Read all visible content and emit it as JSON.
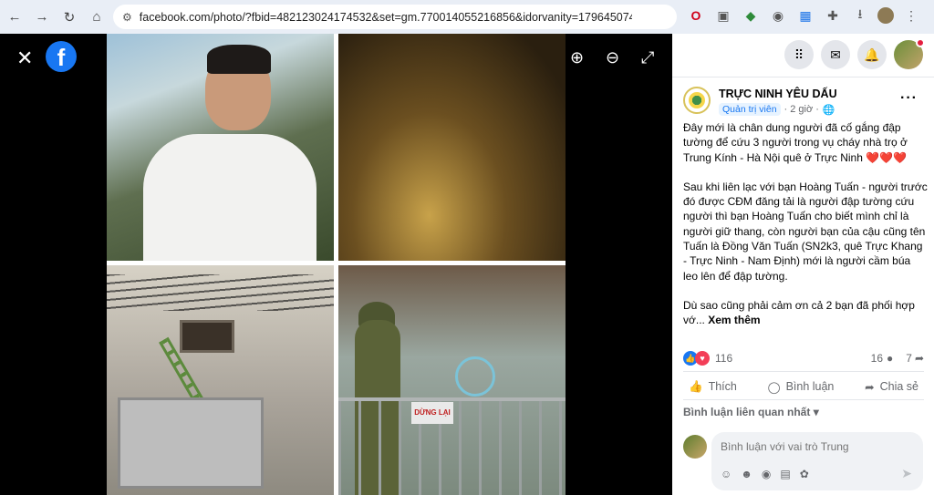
{
  "browser": {
    "url": "facebook.com/photo/?fbid=482123024174532&set=gm.770014055216856&idorvanity=179645074253760",
    "nav": {
      "back": "←",
      "forward": "→",
      "reload": "↻",
      "home": "⌂"
    }
  },
  "viewer": {
    "close": "✕",
    "logo": "f",
    "zoom_in": "⊕",
    "zoom_out": "⊖",
    "fullscreen": "⤢",
    "sign_text": "DỪNG LẠI"
  },
  "post": {
    "group_name": "TRỰC NINH YÊU DẤU",
    "role": "Quản trị viên",
    "time": "· 2 giờ ·",
    "paragraph_1": "Đây mới là chân dung người đã cố gắng đập tường để cứu 3 người trong vụ cháy nhà trọ ở Trung Kính - Hà Nội quê ở Trực Ninh ❤️❤️❤️",
    "paragraph_2": "Sau khi liên lạc với bạn Hoàng Tuấn - người trước đó được CĐM đăng tải là người đập tường cứu người thì bạn Hoàng Tuấn cho biết mình chỉ là người giữ thang, còn người bạn của cậu cũng tên Tuấn là Đồng Văn Tuấn (SN2k3, quê Trực Khang - Trực Ninh - Nam Định) mới là người cầm búa leo lên để đập tường.",
    "paragraph_3": "Dù sao cũng phải cảm ơn cả 2 bạn đã phối hợp vớ...",
    "see_more": "Xem thêm"
  },
  "stats": {
    "reactions": "116",
    "comments": "16",
    "shares": "7"
  },
  "actions": {
    "like": "Thích",
    "comment": "Bình luận",
    "share": "Chia sẻ"
  },
  "comments": {
    "sort_label": "Bình luận liên quan nhất",
    "input_placeholder": "Bình luận với vai trò Trung"
  }
}
